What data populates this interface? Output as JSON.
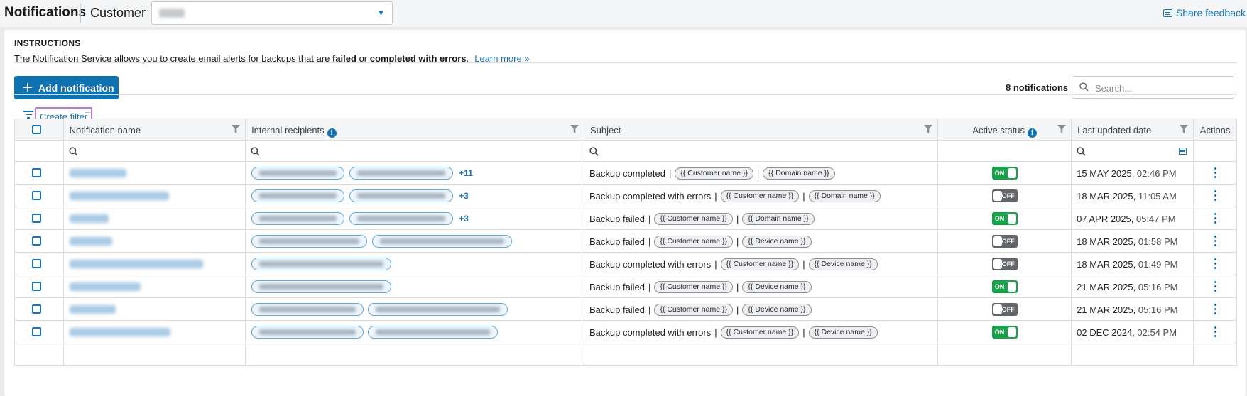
{
  "header": {
    "title": "Notifications",
    "customer_label": "Customer",
    "share_feedback": "Share feedback"
  },
  "instructions": {
    "title": "INSTRUCTIONS",
    "text_before": "The Notification Service allows you to create email alerts for backups that are ",
    "bold1": "failed",
    "text_mid": " or ",
    "bold2": "completed with errors",
    "text_end": ".",
    "learn_more": "Learn more »"
  },
  "toolbar": {
    "add_label": "Add notification",
    "count": "8 notifications",
    "search_placeholder": "Search...",
    "create_filter": "Create filter"
  },
  "columns": {
    "name": "Notification name",
    "recipients": "Internal recipients",
    "subject": "Subject",
    "active": "Active status",
    "updated": "Last updated date",
    "actions": "Actions"
  },
  "rows": [
    {
      "subject": "Backup completed",
      "tags": [
        "{{ Customer name }}",
        "{{ Domain name }}"
      ],
      "more": "+11",
      "status": "ON",
      "date": "15 MAY 2025,",
      "time": " 02:46 PM"
    },
    {
      "subject": "Backup completed with errors",
      "tags": [
        "{{ Customer name }}",
        "{{ Domain name }}"
      ],
      "more": "+3",
      "status": "OFF",
      "date": "18 MAR 2025,",
      "time": " 11:05 AM"
    },
    {
      "subject": "Backup failed",
      "tags": [
        "{{ Customer name }}",
        "{{ Domain name }}"
      ],
      "more": "+3",
      "status": "ON",
      "date": "07 APR 2025,",
      "time": " 05:47 PM"
    },
    {
      "subject": "Backup failed",
      "tags": [
        "{{ Customer name }}",
        "{{ Device name }}"
      ],
      "more": "",
      "status": "OFF",
      "date": "18 MAR 2025,",
      "time": " 01:58 PM"
    },
    {
      "subject": "Backup completed with errors",
      "tags": [
        "{{ Customer name }}",
        "{{ Device name }}"
      ],
      "more": "",
      "status": "OFF",
      "date": "18 MAR 2025,",
      "time": " 01:49 PM"
    },
    {
      "subject": "Backup failed",
      "tags": [
        "{{ Customer name }}",
        "{{ Device name }}"
      ],
      "more": "",
      "status": "ON",
      "date": "21 MAR 2025,",
      "time": " 05:16 PM"
    },
    {
      "subject": "Backup failed",
      "tags": [
        "{{ Customer name }}",
        "{{ Device name }}"
      ],
      "more": "",
      "status": "OFF",
      "date": "21 MAR 2025,",
      "time": " 05:16 PM"
    },
    {
      "subject": "Backup completed with errors",
      "tags": [
        "{{ Customer name }}",
        "{{ Device name }}"
      ],
      "more": "",
      "status": "ON",
      "date": "02 DEC 2024,",
      "time": " 02:54 PM"
    }
  ],
  "icons": [
    "filter-icon",
    "info-icon",
    "search-icon",
    "calendar-icon",
    "kebab-icon",
    "feedback-icon",
    "plus-icon",
    "chevron-down-icon"
  ],
  "colors": {
    "accent": "#1574b7",
    "primary_button": "#0f71b0",
    "toggle_on": "#17a34a",
    "toggle_off": "#62666b",
    "highlight": "#b57ad8"
  }
}
